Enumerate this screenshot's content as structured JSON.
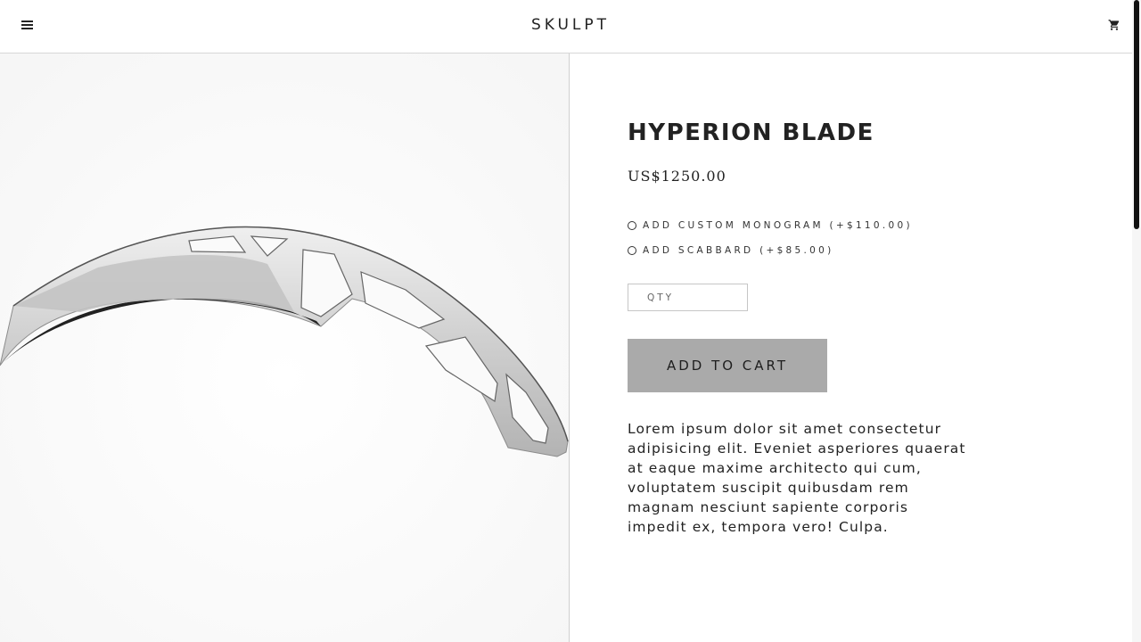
{
  "header": {
    "brand": "SKULPT",
    "menu_icon": "hamburger-menu-icon",
    "cart_icon": "shopping-cart-icon"
  },
  "product": {
    "image_alt": "Hyperion Blade",
    "title": "HYPERION BLADE",
    "price": "US$1250.00",
    "options": [
      {
        "label": "ADD CUSTOM MONOGRAM (+$110.00)"
      },
      {
        "label": "ADD SCABBARD (+$85.00)"
      }
    ],
    "qty_placeholder": "QTY",
    "add_to_cart_label": "ADD TO CART",
    "description": "Lorem ipsum dolor sit amet consectetur adipisicing elit. Eveniet asperiores quaerat at eaque maxime architecto qui cum, voluptatem suscipit quibusdam rem magnam nesciunt sapiente corporis impedit ex, tempora vero! Culpa."
  },
  "colors": {
    "button_bg": "#aaaaaa",
    "text": "#222222",
    "divider": "#d7d7d7",
    "scroll_thumb": "#111111"
  }
}
